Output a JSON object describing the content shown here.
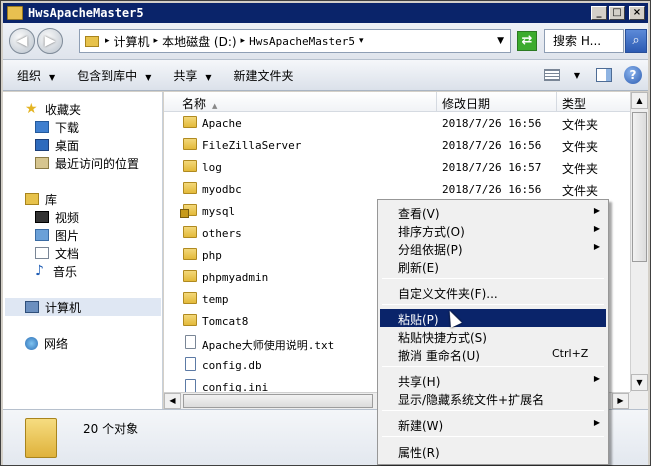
{
  "window": {
    "title": "HwsApacheMaster5"
  },
  "address": {
    "crumbs": [
      "计算机",
      "本地磁盘 (D:)",
      "HwsApacheMaster5"
    ],
    "search_placeholder": "搜索 H..."
  },
  "toolbar": {
    "organize": "组织",
    "include_in_library": "包含到库中",
    "share": "共享",
    "new_folder": "新建文件夹"
  },
  "nav": {
    "favorites": "收藏夹",
    "downloads": "下载",
    "desktop": "桌面",
    "recent": "最近访问的位置",
    "libraries": "库",
    "videos": "视频",
    "pictures": "图片",
    "documents": "文档",
    "music": "音乐",
    "computer": "计算机",
    "network": "网络"
  },
  "columns": {
    "name": "名称",
    "date": "修改日期",
    "type": "类型"
  },
  "files": [
    {
      "name": "Apache",
      "date": "2018/7/26 16:56",
      "type": "文件夹",
      "icon": "folder-icon"
    },
    {
      "name": "FileZillaServer",
      "date": "2018/7/26 16:56",
      "type": "文件夹",
      "icon": "folder-icon"
    },
    {
      "name": "log",
      "date": "2018/7/26 16:57",
      "type": "文件夹",
      "icon": "folder-icon"
    },
    {
      "name": "myodbc",
      "date": "2018/7/26 16:56",
      "type": "文件夹",
      "icon": "folder-icon"
    },
    {
      "name": "mysql",
      "date": "",
      "type": "",
      "icon": "locked-folder-icon"
    },
    {
      "name": "others",
      "date": "",
      "type": "",
      "icon": "folder-icon"
    },
    {
      "name": "php",
      "date": "",
      "type": "",
      "icon": "folder-icon"
    },
    {
      "name": "phpmyadmin",
      "date": "",
      "type": "",
      "icon": "folder-icon"
    },
    {
      "name": "temp",
      "date": "",
      "type": "",
      "icon": "folder-icon"
    },
    {
      "name": "Tomcat8",
      "date": "",
      "type": "",
      "icon": "folder-icon"
    },
    {
      "name": "Apache大师使用说明.txt",
      "date": "",
      "type": "",
      "icon": "text-file-icon"
    },
    {
      "name": "config.db",
      "date": "",
      "type": "",
      "icon": "db-file-icon"
    },
    {
      "name": "config.ini",
      "date": "",
      "type": "",
      "icon": "ini-file-icon"
    }
  ],
  "details": {
    "count": "20 个对象"
  },
  "context_menu": {
    "view": "查看(V)",
    "sort_by": "排序方式(O)",
    "group_by": "分组依据(P)",
    "refresh": "刷新(E)",
    "customize": "自定义文件夹(F)...",
    "paste": "粘贴(P)",
    "paste_shortcut": "粘贴快捷方式(S)",
    "undo_rename": "撤消 重命名(U)",
    "undo_shortcut": "Ctrl+Z",
    "share": "共享(H)",
    "show_hide": "显示/隐藏系统文件+扩展名",
    "new": "新建(W)",
    "properties": "属性(R)"
  },
  "colors": {
    "title_bar": "#0a246a",
    "menu_highlight": "#0a246a"
  }
}
